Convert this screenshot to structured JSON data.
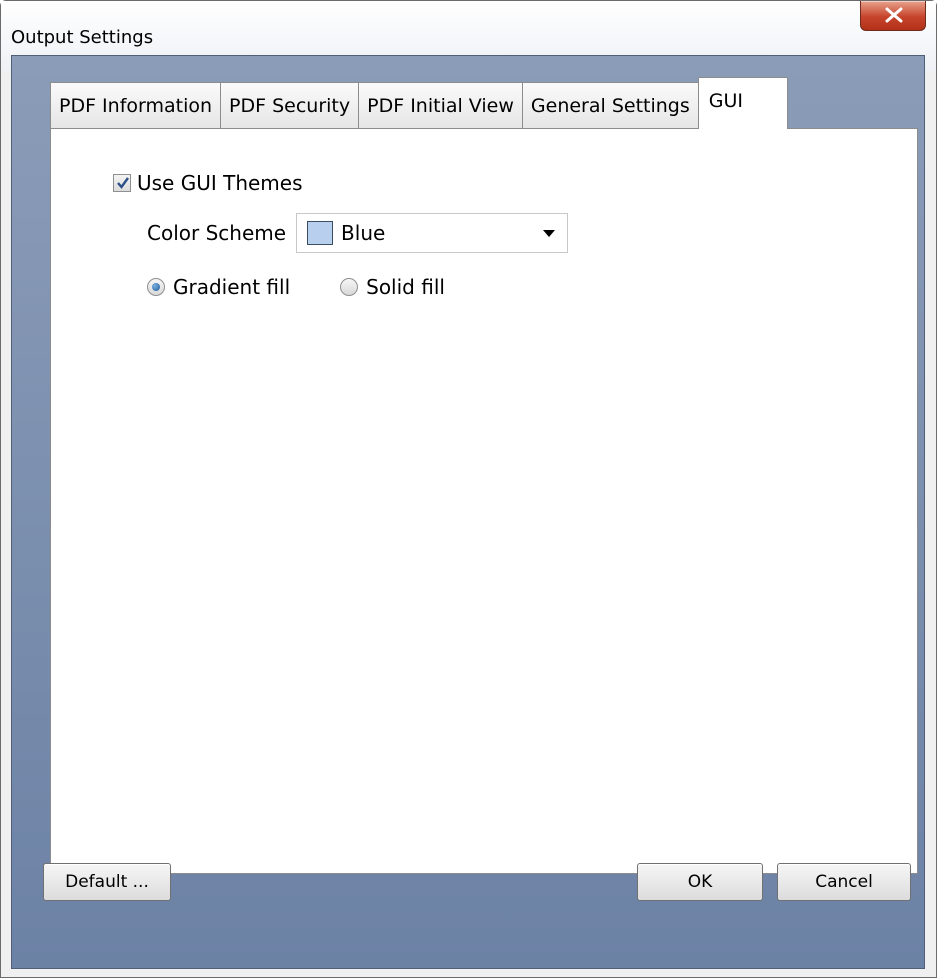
{
  "window": {
    "title": "Output Settings"
  },
  "tabs": [
    {
      "label": "PDF Information"
    },
    {
      "label": "PDF Security"
    },
    {
      "label": "PDF Initial View"
    },
    {
      "label": "General Settings"
    },
    {
      "label": "GUI",
      "active": true
    }
  ],
  "gui": {
    "use_themes_label": "Use GUI Themes",
    "use_themes_checked": true,
    "color_scheme_label": "Color Scheme",
    "color_scheme_value": "Blue",
    "color_scheme_swatch": "#b8cfee",
    "fill_options": [
      {
        "label": "Gradient fill",
        "checked": true
      },
      {
        "label": "Solid fill",
        "checked": false
      }
    ]
  },
  "buttons": {
    "default_label": "Default ...",
    "ok_label": "OK",
    "cancel_label": "Cancel"
  }
}
